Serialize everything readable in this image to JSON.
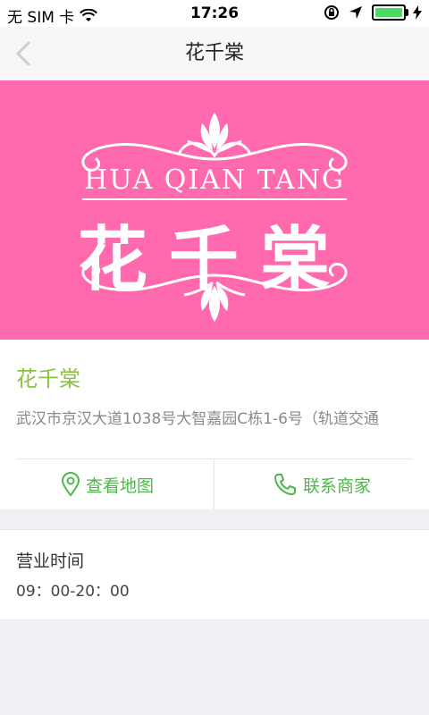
{
  "status_bar": {
    "carrier": "无 SIM 卡",
    "time": "17:26"
  },
  "nav": {
    "title": "花千棠"
  },
  "banner": {
    "brand_en": "HUA QIAN TANG",
    "brand_cn": "花千棠",
    "bg_color": "#ff69ad"
  },
  "shop": {
    "name": "花千棠",
    "address": "武汉市京汉大道1038号大智嘉园C栋1-6号（轨道交通"
  },
  "actions": {
    "map_label": "查看地图",
    "contact_label": "联系商家"
  },
  "hours": {
    "label": "营业时间",
    "value": "09：00-20：00"
  },
  "colors": {
    "accent_green": "#4cb848",
    "shop_name_green": "#8ac43f"
  }
}
